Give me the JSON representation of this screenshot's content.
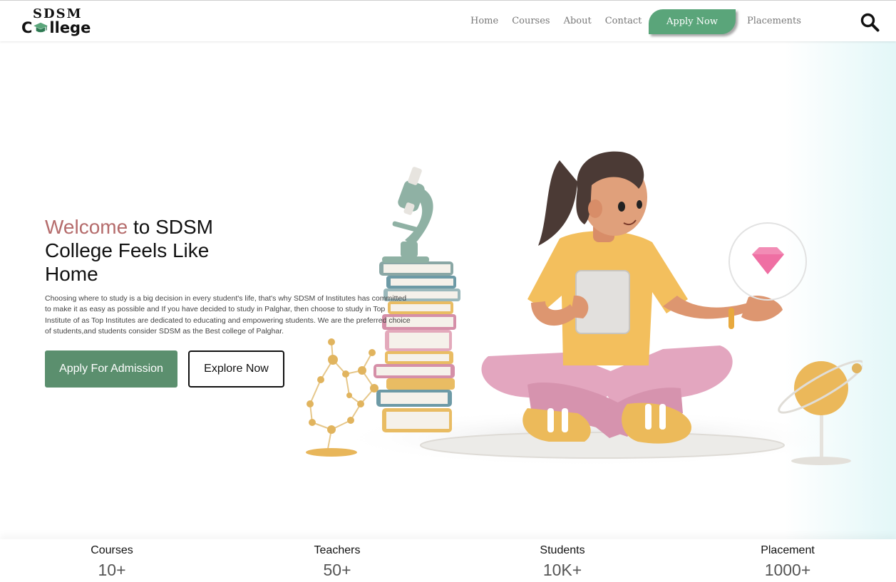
{
  "brand": {
    "top": "SDSM",
    "bottom_start": "C",
    "bottom_end": "llege",
    "accent_color": "#5aa57a"
  },
  "nav": {
    "links": [
      "Home",
      "Courses",
      "About",
      "Contact"
    ],
    "apply_label": "Apply Now",
    "placements_label": "Placements",
    "search_icon": "search-icon"
  },
  "hero": {
    "title_accent": "Welcome",
    "title_rest": " to SDSM College Feels Like Home",
    "description": "Choosing where to study is a big decision in every student's life, that's why SDSM of Institutes has committed to make it as easy as possible and If you have decided to study in Palghar, then choose to study in Top Institute of as Top Institutes are dedicated to educating and empowering students. We are the preferred choice of students,and students consider SDSM as the Best college of Palghar.",
    "primary_button": "Apply For Admission",
    "secondary_button": "Explore Now",
    "colors": {
      "accent": "#b56c6c",
      "primary_button": "#5b8f6e"
    }
  },
  "stats": [
    {
      "label": "Courses",
      "value": "10+"
    },
    {
      "label": "Teachers",
      "value": "50+"
    },
    {
      "label": "Students",
      "value": "10K+"
    },
    {
      "label": "Placement",
      "value": "1000+"
    }
  ]
}
